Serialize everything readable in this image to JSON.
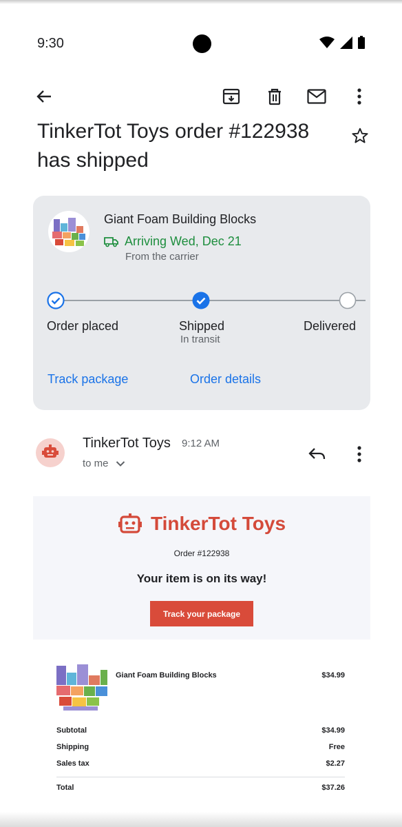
{
  "status_bar": {
    "time": "9:30"
  },
  "toolbar": {
    "icons": [
      "back-arrow-icon",
      "archive-icon",
      "trash-icon",
      "mail-icon",
      "more-vert-icon"
    ]
  },
  "email": {
    "subject": "TinkerTot Toys order #122938 has shipped"
  },
  "shipment_card": {
    "product_name": "Giant Foam Building Blocks",
    "arriving": "Arriving Wed, Dec 21",
    "carrier_note": "From the carrier",
    "steps": [
      {
        "label": "Order placed",
        "sub": "",
        "state": "done"
      },
      {
        "label": "Shipped",
        "sub": "In transit",
        "state": "current"
      },
      {
        "label": "Delivered",
        "sub": "",
        "state": "pending"
      }
    ],
    "links": {
      "track": "Track package",
      "details": "Order details"
    }
  },
  "sender": {
    "name": "TinkerTot Toys",
    "time": "9:12 AM",
    "recipient": "to me"
  },
  "body": {
    "brand": "TinkerTot Toys",
    "order_number": "Order #122938",
    "headline": "Your item is on its way!",
    "cta": "Track your package",
    "item": {
      "name": "Giant Foam Building Blocks",
      "price": "$34.99"
    },
    "summary": {
      "subtotal_label": "Subtotal",
      "subtotal": "$34.99",
      "shipping_label": "Shipping",
      "shipping": "Free",
      "tax_label": "Sales tax",
      "tax": "$2.27",
      "total_label": "Total",
      "total": "$37.26"
    }
  },
  "colors": {
    "accent": "#1a73e8",
    "green": "#1e8e3e",
    "brand": "#d44a3a"
  }
}
